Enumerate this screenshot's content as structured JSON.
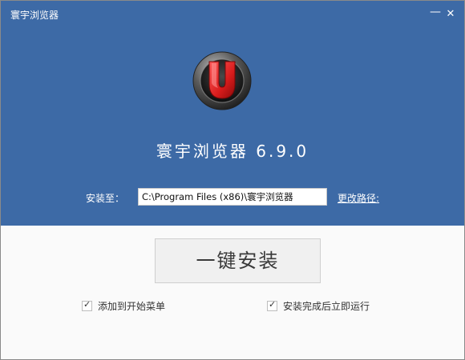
{
  "window": {
    "title": "寰宇浏览器"
  },
  "header": {
    "app_name": "寰宇浏览器  6.9.0"
  },
  "install": {
    "path_label": "安装至：",
    "path_value": "C:\\Program Files (x86)\\寰宇浏览器",
    "change_path_label": "更改路径:",
    "install_button_label": "一键安装"
  },
  "options": [
    {
      "label": "添加到开始菜单",
      "checked": true
    },
    {
      "label": "安装完成后立即运行",
      "checked": true
    }
  ],
  "colors": {
    "header_bg": "#3d6aa6",
    "logo_red": "#e02020",
    "button_bg": "#f0f0f0"
  },
  "icons": {
    "logo": "u-magnet-logo-icon",
    "minimize": "minimize-icon",
    "close": "close-icon",
    "checkbox": "checkmark-icon"
  }
}
